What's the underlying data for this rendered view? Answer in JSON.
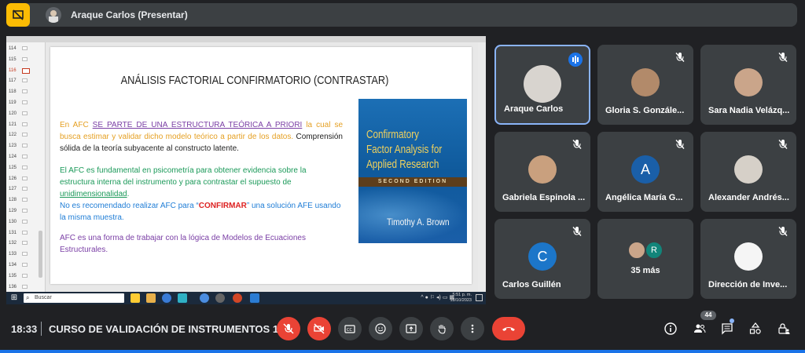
{
  "topbar": {
    "presenter_label": "Araque Carlos (Presentar)"
  },
  "slides_panel": {
    "rows": [
      "114",
      "115",
      "116",
      "117",
      "118",
      "119",
      "120",
      "121",
      "122",
      "123",
      "124",
      "125",
      "126",
      "127",
      "128",
      "129",
      "130",
      "131",
      "132",
      "133",
      "134",
      "135",
      "136"
    ],
    "active_row": "116"
  },
  "slide": {
    "title": "ANÁLISIS FACTORIAL CONFIRMATORIO (CONTRASTAR)",
    "p1_a": "En AFC ",
    "p1_b": "SE PARTE DE UNA ESTRUCTURA TEÓRICA A PRIORI",
    "p1_c": " la cual se busca estimar y validar dicho modelo teórico a partir de los datos. ",
    "p1_d": "Comprensión sólida de la teoría subyacente al constructo latente.",
    "p2_a": "El AFC es fundamental en psicometría para obtener evidencia sobre la estructura interna del instrumento y para contrastar el supuesto de ",
    "p2_b": "unidimensionalidad",
    "p2_c": ".",
    "p3_a": "No es recomendado realizar AFC para “",
    "p3_b": "CONFIRMAR",
    "p3_c": "” una solución AFE usando la misma muestra.",
    "p4": "AFC es una forma de trabajar con la lógica de Modelos de Ecuaciones Estructurales.",
    "book": {
      "title_line1": "Confirmatory",
      "title_line2": "Factor Analysis for",
      "title_line3": "Applied Research",
      "edition": "SECOND EDITION",
      "author": "Timothy A. Brown"
    }
  },
  "windows_taskbar": {
    "search_placeholder": "Buscar",
    "clock_time": "5:51 p. m.",
    "clock_date": "18/10/2023"
  },
  "participants": [
    {
      "name": "Araque Carlos",
      "status": "speaking"
    },
    {
      "name": "Gloria S. Gonzále...",
      "status": "muted"
    },
    {
      "name": "Sara Nadia Velázq...",
      "status": "muted"
    },
    {
      "name": "Gabriela Espinola ...",
      "status": "muted"
    },
    {
      "name": "Angélica María G...",
      "status": "muted",
      "initial": "A"
    },
    {
      "name": "Alexander Andrés...",
      "status": "muted"
    },
    {
      "name": "Carlos Guillén",
      "status": "muted",
      "initial": "C"
    },
    {
      "name": "35 más",
      "status": "overflow",
      "initial": "R"
    },
    {
      "name": "Dirección de Inve...",
      "status": "muted"
    }
  ],
  "bottombar": {
    "time": "18:33",
    "meeting_title": "CURSO DE VALIDACIÓN DE INSTRUMENTOS 1...",
    "participant_count": "44"
  },
  "colors": {
    "background": "#202124",
    "tile": "#3c4043",
    "danger": "#ea4335",
    "accent": "#8ab4f8",
    "meet_blue": "#1a73e8"
  }
}
